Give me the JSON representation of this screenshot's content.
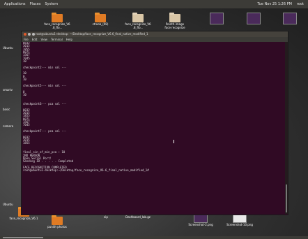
{
  "top_panel": {
    "applications": "Applications",
    "places": "Places",
    "system": "System",
    "clock": "Tue Nov 25  1:26 PM",
    "user": "root"
  },
  "desktop_icons": {
    "top": [
      {
        "label": "face_recognize_V6\n.8_flo...",
        "kind": "folder"
      },
      {
        "label": "stroob_(08)",
        "kind": "folder"
      },
      {
        "label": "face_recognize_V6\n.8_flo...",
        "kind": "folder-light"
      },
      {
        "label": "Pointh image\nface recognize",
        "kind": "folder-light"
      }
    ],
    "left": [
      "Ubuntu",
      "smartv",
      "basic",
      "camera",
      "Ubuntu"
    ],
    "bottom": [
      {
        "label": "face_recognize_V6.1",
        "kind": "folder"
      },
      {
        "label": "zip",
        "kind": "none"
      },
      {
        "label": "Dashboard_lab.gz",
        "kind": "none"
      },
      {
        "label": "Screenshot-2.png",
        "kind": "thumb"
      },
      {
        "label": "Screenshot-10.png",
        "kind": "thumb-white"
      },
      {
        "label": "punith photos",
        "kind": "folder"
      }
    ]
  },
  "terminal": {
    "title": "root@ubuntu1-desktop: ~/Desktop/face_recognize_V6.6_final_native_modified_1",
    "menu": [
      "File",
      "Edit",
      "View",
      "Terminal",
      "Help"
    ],
    "lines": [
      "0832",
      "3015",
      "1855",
      "8071",
      "1567",
      "7045",
      "10",
      "",
      "checkpoint2--- min val ---",
      "",
      "10",
      "0",
      "10",
      "",
      "checkpoint5--- min val ---",
      "",
      "0",
      "10",
      "",
      "",
      "checkpoint6--- pca val ---",
      "",
      "8032",
      "3015",
      "1855",
      "8071",
      "1567",
      "7045",
      "",
      "checkpoint7--- pca val ---",
      "",
      "8032",
      "3015",
      "1855",
      "",
      "",
      "final_sin_of_min_pca : 10",
      "2ND PERSON",
      "Open Serial Port!",
      "Sending ID . . . . . Completed",
      "",
      "FACE_RECOGNITION COMPLETED",
      "root@ubuntu1-desktop:~/Desktop/face_recognize_V6.6_final_native_modified_1#"
    ]
  }
}
